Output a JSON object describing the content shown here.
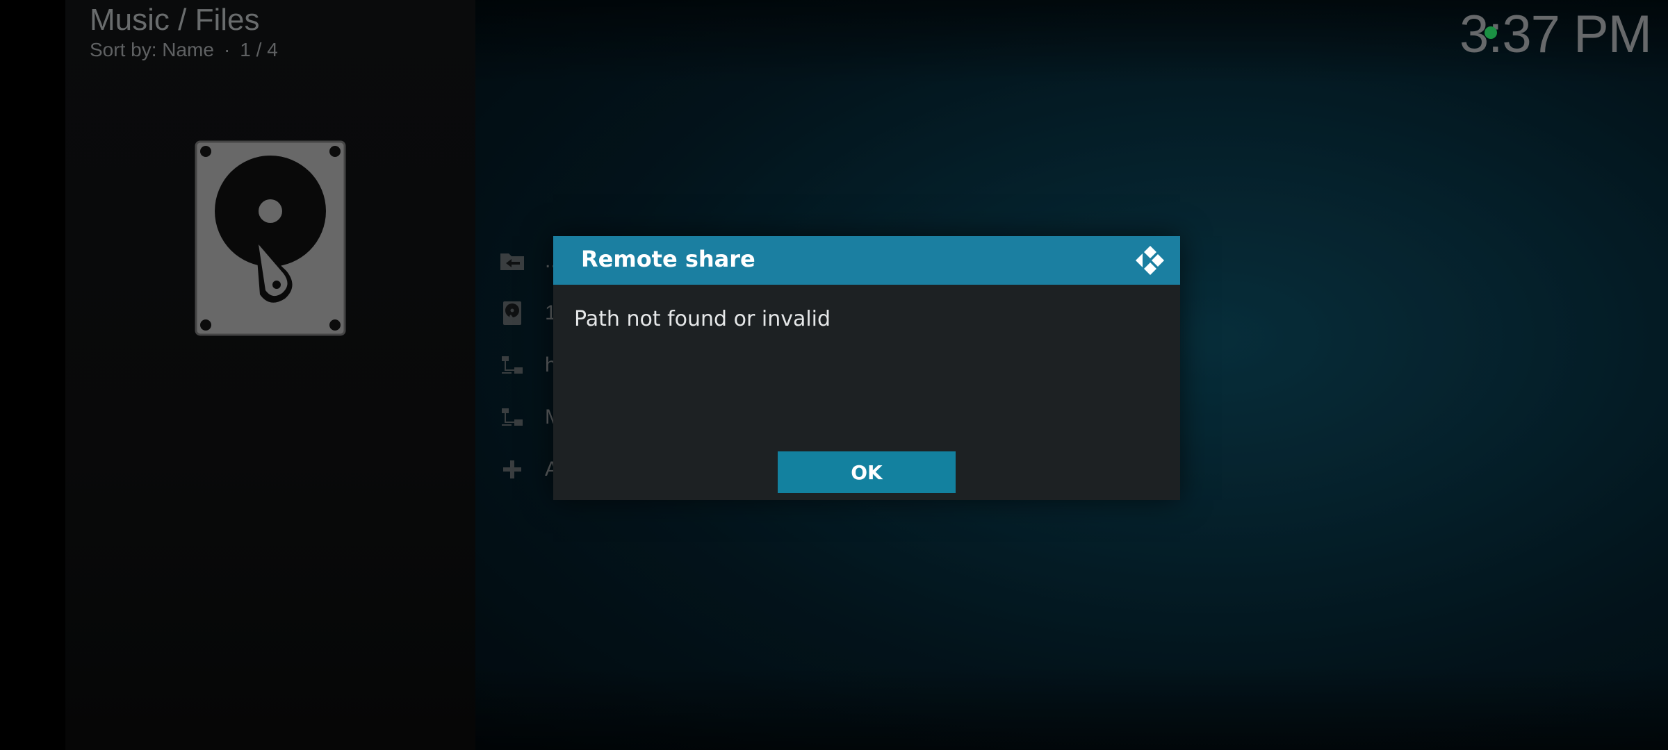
{
  "header": {
    "title": "Music / Files",
    "sort_label": "Sort by: Name",
    "separator": "·",
    "position": "1 / 4"
  },
  "clock": {
    "time": "3:37 PM",
    "status_color": "#25c05a"
  },
  "list": {
    "items": [
      {
        "icon": "folder-back-icon",
        "label": ".."
      },
      {
        "icon": "hard-drive-icon",
        "label": "1"
      },
      {
        "icon": "network-icon",
        "label": "h"
      },
      {
        "icon": "network-icon",
        "label": "M"
      },
      {
        "icon": "plus-icon",
        "label": "A"
      }
    ]
  },
  "dialog": {
    "title": "Remote share",
    "message": "Path not found or invalid",
    "ok_label": "OK",
    "logo": "kodi-logo-icon",
    "header_color": "#1b7fa1",
    "button_color": "#13819f"
  }
}
